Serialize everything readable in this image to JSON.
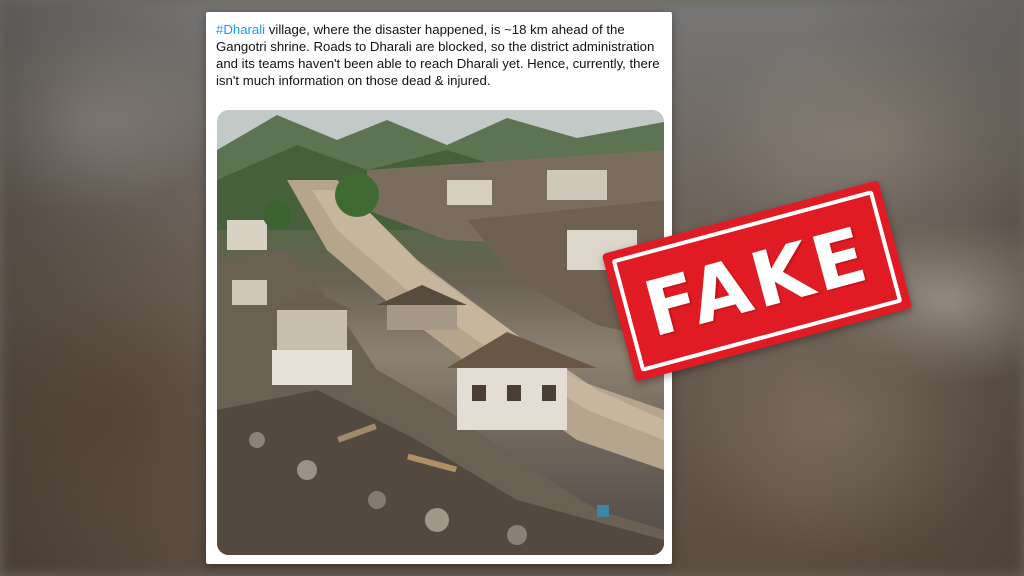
{
  "tweet": {
    "hashtag": "#Dharali",
    "text": " village, where the disaster happened, is ~18 km ahead of the Gangotri shrine. Roads to Dharali are blocked, so the district administration and its teams haven't been able to reach Dharali yet. Hence, currently, there isn't much information on those dead & injured."
  },
  "photo": {
    "subject": "flood-ravaged-village-photo"
  },
  "stamp": {
    "label": "FAKE",
    "color": "#e01b24"
  },
  "colors": {
    "hashtag": "#1d9bf0",
    "text": "#0f1419"
  }
}
